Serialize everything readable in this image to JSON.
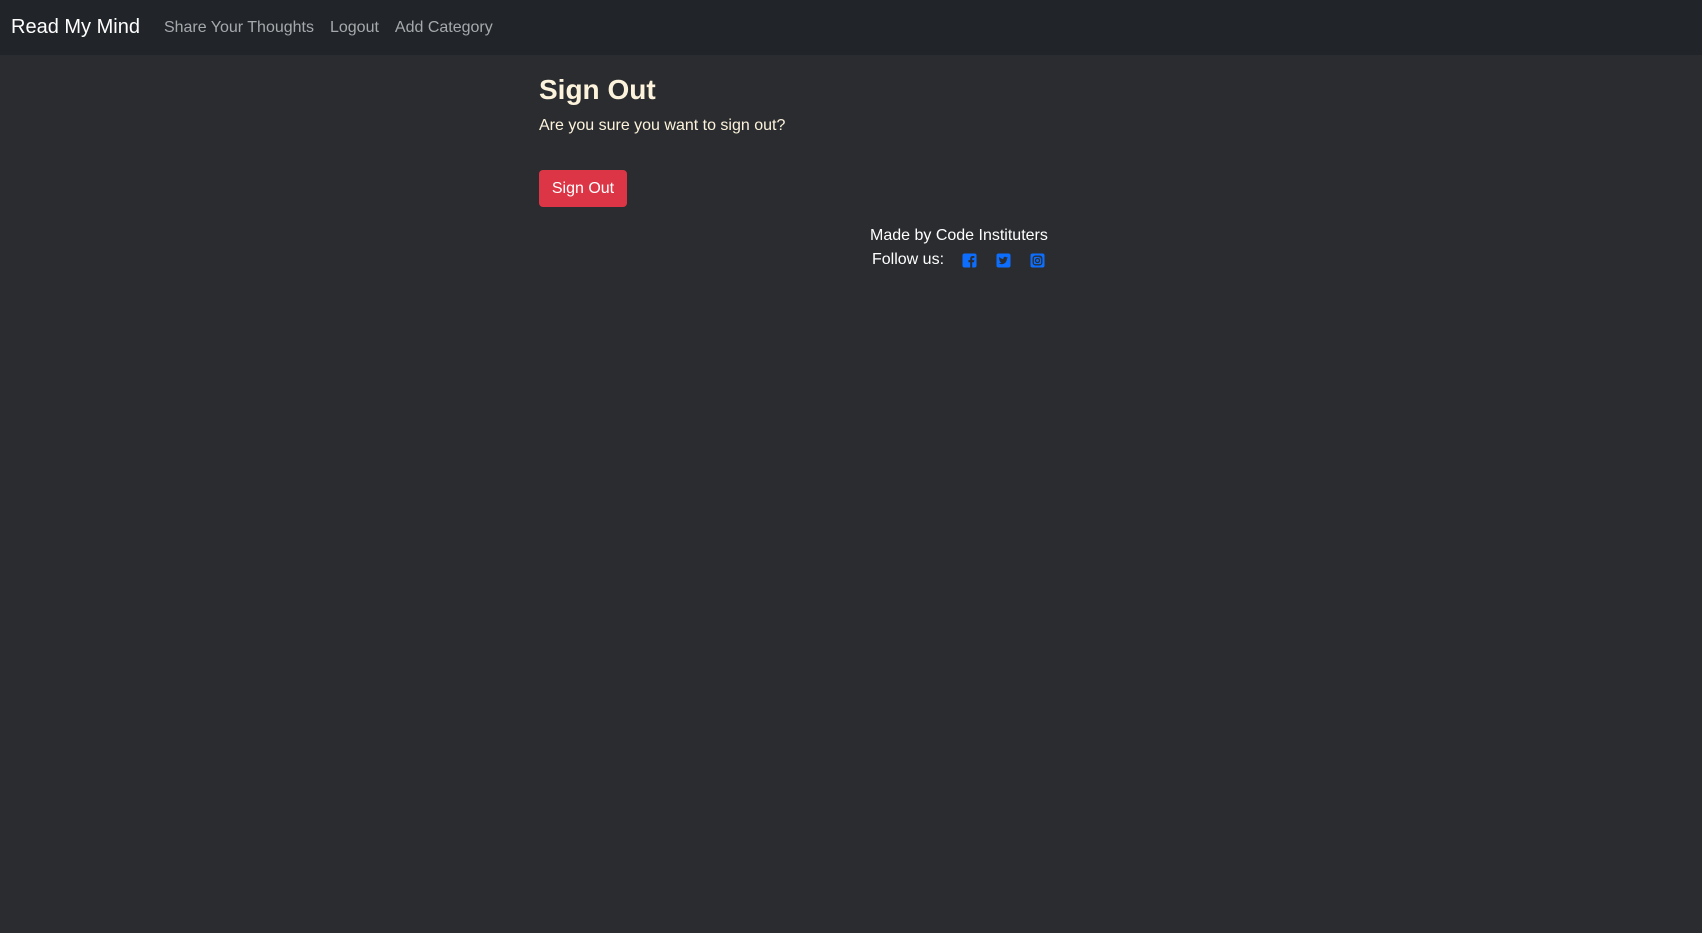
{
  "nav": {
    "brand": "Read My Mind",
    "links": [
      "Share Your Thoughts",
      "Logout",
      "Add Category"
    ]
  },
  "main": {
    "title": "Sign Out",
    "confirm_text": "Are you sure you want to sign out?",
    "button_label": "Sign Out"
  },
  "footer": {
    "made_by": "Made by Code Instituters",
    "follow_label": "Follow us:",
    "social_icons": [
      "facebook-icon",
      "twitter-icon",
      "instagram-icon"
    ]
  },
  "colors": {
    "page_bg": "#2a2c2f",
    "navbar_bg": "#212529",
    "accent_text": "#fdf3dc",
    "danger": "#dc3545",
    "social_icon": "#0d6efd"
  }
}
